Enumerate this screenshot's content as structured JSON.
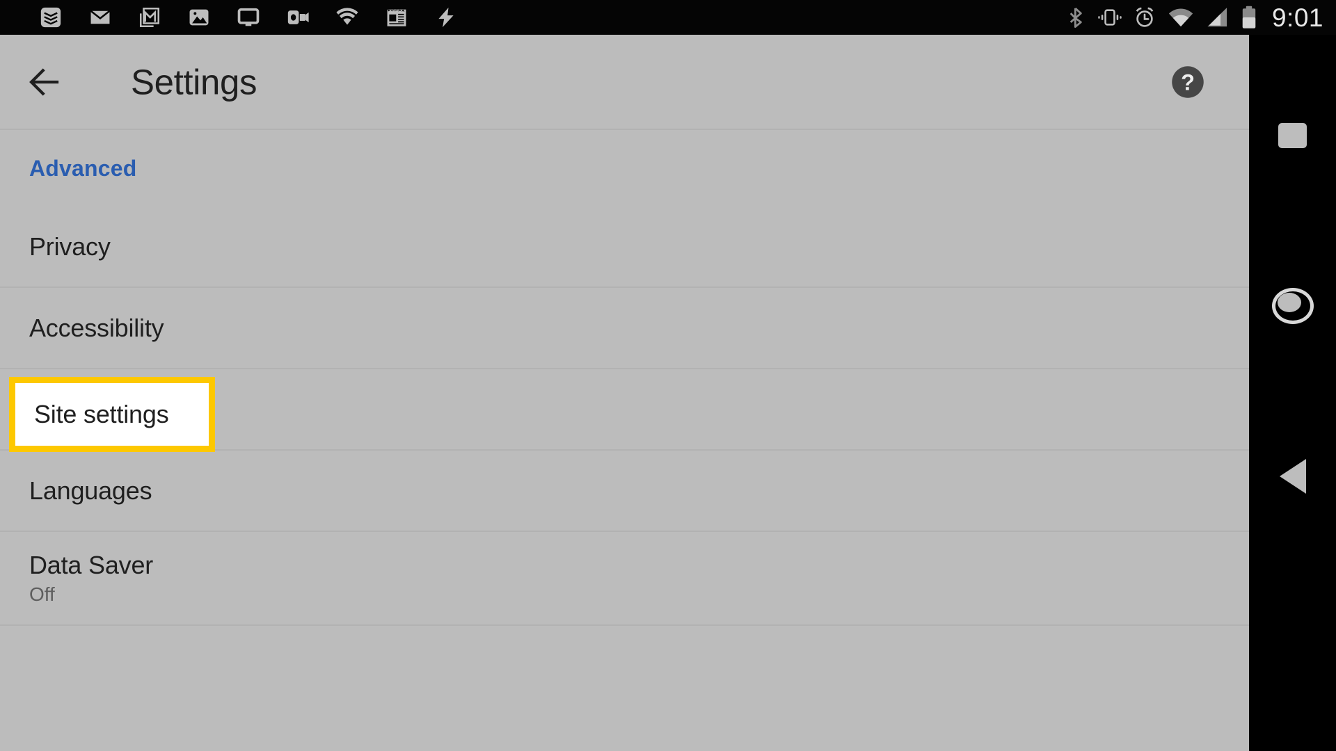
{
  "status_bar": {
    "left_icons": [
      {
        "name": "todoist-icon",
        "label": "Todoist"
      },
      {
        "name": "email-icon",
        "label": "Email"
      },
      {
        "name": "gmail-icon",
        "label": "Gmail"
      },
      {
        "name": "photos-icon",
        "label": "Photos"
      },
      {
        "name": "cast-screen-icon",
        "label": "Cast screen"
      },
      {
        "name": "outlook-icon",
        "label": "Outlook"
      },
      {
        "name": "wifi-notification-icon",
        "label": "Wi-Fi"
      },
      {
        "name": "news-icon",
        "label": "News"
      },
      {
        "name": "flash-charging-icon",
        "label": "Charging"
      }
    ],
    "right_icons": [
      {
        "name": "bluetooth-icon",
        "label": "Bluetooth"
      },
      {
        "name": "vibrate-icon",
        "label": "Vibrate"
      },
      {
        "name": "alarm-icon",
        "label": "Alarm set"
      },
      {
        "name": "wifi-signal-icon",
        "label": "Wi-Fi signal"
      },
      {
        "name": "cellular-signal-icon",
        "label": "Cellular signal"
      },
      {
        "name": "battery-icon",
        "label": "Battery"
      }
    ],
    "time": "9:01"
  },
  "toolbar": {
    "back_label": "Navigate up",
    "title": "Settings",
    "help_label": "Help & feedback"
  },
  "section": {
    "header": "Advanced"
  },
  "settings_items": [
    {
      "title": "Privacy",
      "subtitle": "",
      "highlighted": false
    },
    {
      "title": "Accessibility",
      "subtitle": "",
      "highlighted": false
    },
    {
      "title": "Site settings",
      "subtitle": "",
      "highlighted": true
    },
    {
      "title": "Languages",
      "subtitle": "",
      "highlighted": false
    },
    {
      "title": "Data Saver",
      "subtitle": "Off",
      "highlighted": false
    }
  ],
  "nav_bar": {
    "recents_label": "Overview",
    "home_label": "Home",
    "back_label": "Back"
  },
  "colors": {
    "accent_blue": "#2a5db0",
    "highlight_yellow": "#fdc800",
    "background_gray": "#bcbcbc",
    "text_primary": "#1f1f1f",
    "text_secondary": "#5e5e5e"
  }
}
